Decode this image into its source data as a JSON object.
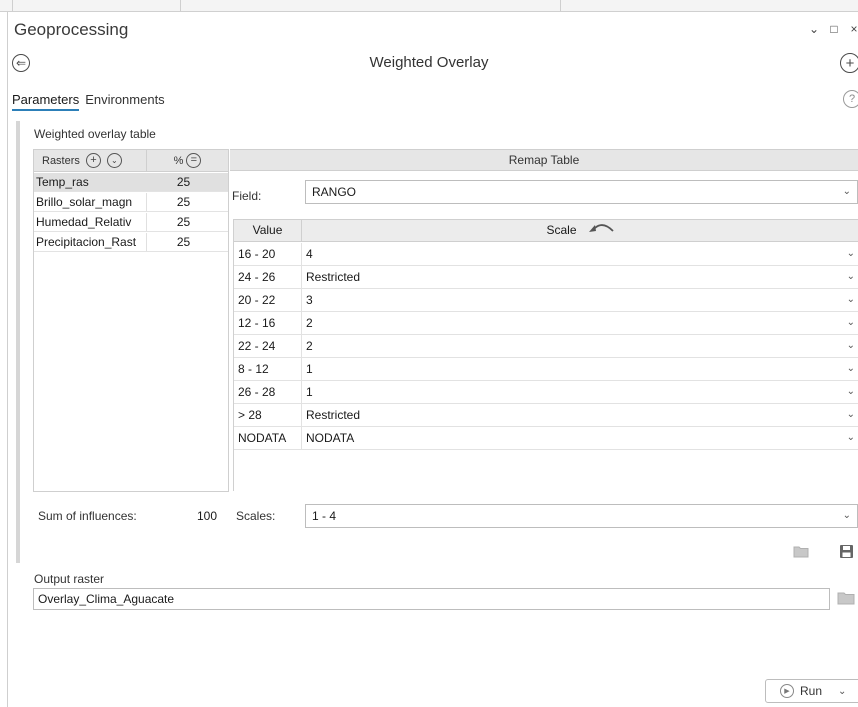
{
  "pane": {
    "title": "Geoprocessing",
    "controls": [
      "⌄",
      "□",
      "×"
    ]
  },
  "tool": {
    "title": "Weighted Overlay",
    "back_icon": "⇐",
    "add_icon": "+"
  },
  "tabs": [
    {
      "label": "Parameters",
      "active": true
    },
    {
      "label": "Environments",
      "active": false
    }
  ],
  "help_icon": "?",
  "weighted_overlay_table": {
    "label": "Weighted overlay table",
    "rasters_header": "Rasters",
    "percent_header": "%",
    "rasters": [
      {
        "name": "Temp_ras",
        "percent": "25",
        "selected": true
      },
      {
        "name": "Brillo_solar_magn",
        "percent": "25",
        "selected": false
      },
      {
        "name": "Humedad_Relativ",
        "percent": "25",
        "selected": false
      },
      {
        "name": "Precipitacion_Rast",
        "percent": "25",
        "selected": false
      }
    ],
    "sum_label": "Sum of influences:",
    "sum_value": "100"
  },
  "remap": {
    "header": "Remap Table",
    "field_label": "Field:",
    "field_value": "RANGO",
    "value_header": "Value",
    "scale_header": "Scale",
    "rows": [
      {
        "value": "16 - 20",
        "scale": "4"
      },
      {
        "value": "24 - 26",
        "scale": "Restricted"
      },
      {
        "value": "20 - 22",
        "scale": "3"
      },
      {
        "value": "12 - 16",
        "scale": "2"
      },
      {
        "value": "22 - 24",
        "scale": "2"
      },
      {
        "value": "8 - 12",
        "scale": "1"
      },
      {
        "value": "26 - 28",
        "scale": "1"
      },
      {
        "value": "> 28",
        "scale": "Restricted"
      },
      {
        "value": "NODATA",
        "scale": "NODATA"
      }
    ],
    "scales_label": "Scales:",
    "scales_value": "1 - 4"
  },
  "output": {
    "label": "Output raster",
    "value": "Overlay_Clima_Aguacate"
  },
  "run": {
    "label": "Run"
  }
}
